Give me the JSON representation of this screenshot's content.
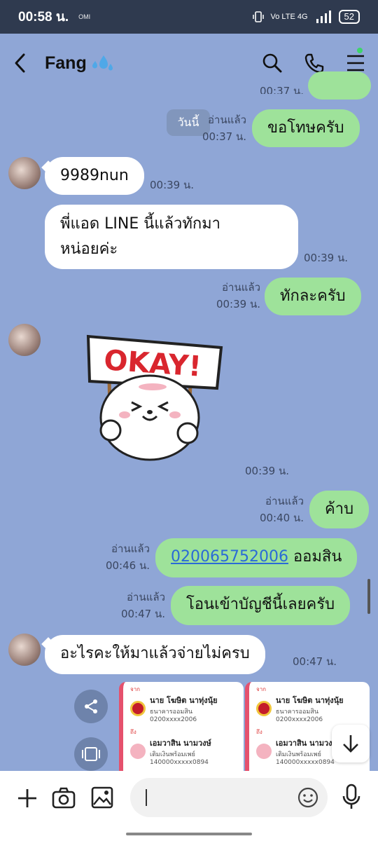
{
  "status_bar": {
    "time": "00:58 น.",
    "extra": "OMI",
    "network": "Vo LTE 4G",
    "battery": "52"
  },
  "header": {
    "contact_name": "Fang",
    "icons": [
      "back-icon",
      "search-icon",
      "phone-icon",
      "menu-icon"
    ]
  },
  "today_pill": "วันนี้",
  "messages": [
    {
      "side": "out",
      "text": "ขอโทษครับ",
      "read": "อ่านแล้ว",
      "time": "00:37 น."
    },
    {
      "side": "in",
      "text": "9989nun",
      "time": "00:39 น."
    },
    {
      "side": "in",
      "text_line1": "พี่แอด LINE นี้แล้วทักมา",
      "text_line2": "หน่อยค่ะ",
      "time": "00:39 น."
    },
    {
      "side": "out",
      "text": "ทักละครับ",
      "read": "อ่านแล้ว",
      "time": "00:39 น."
    },
    {
      "side": "in",
      "sticker": "OKAY!",
      "time": "00:39 น."
    },
    {
      "side": "out",
      "text": "ค้าบ",
      "read": "อ่านแล้ว",
      "time": "00:40 น."
    },
    {
      "side": "out",
      "link": "020065752006",
      "text_after": " ออมสิน",
      "read": "อ่านแล้ว",
      "time": "00:46 น."
    },
    {
      "side": "out",
      "text": "โอนเข้าบัญชีนี้เลยครับ",
      "read": "อ่านแล้ว",
      "time": "00:47 น."
    },
    {
      "side": "in",
      "text": "อะไรคะให้มาแล้วจ่ายไม่ครบ",
      "time": "00:47 น."
    }
  ],
  "top_partial_time": "00:37 น.",
  "slips": [
    {
      "from_label": "จาก",
      "from_name": "นาย โฆษิต นาทุ่งนุ้ย",
      "from_bank": "ธนาคารออมสิน",
      "from_acct": "0200xxxx2006",
      "to_label": "ถึง",
      "to_name": "เอมวาสิน นามวงษ์",
      "to_bank": "เติมเงินพร้อมเพย์",
      "to_acct": "140000xxxxx0894"
    },
    {
      "from_label": "จาก",
      "from_name": "นาย โฆษิต นาทุ่งนุ้ย",
      "from_bank": "ธนาคารออมสิน",
      "from_acct": "0200xxxx2006",
      "to_label": "ถึง",
      "to_name": "เอมวาสิน นามวงษ์",
      "to_bank": "เติมเงินพร้อมเพย์",
      "to_acct": "140000xxxxx0894"
    }
  ],
  "colors": {
    "background": "#8fa6d6",
    "outgoing": "#9ee29a",
    "incoming": "#ffffff",
    "link": "#2a6bd6"
  }
}
